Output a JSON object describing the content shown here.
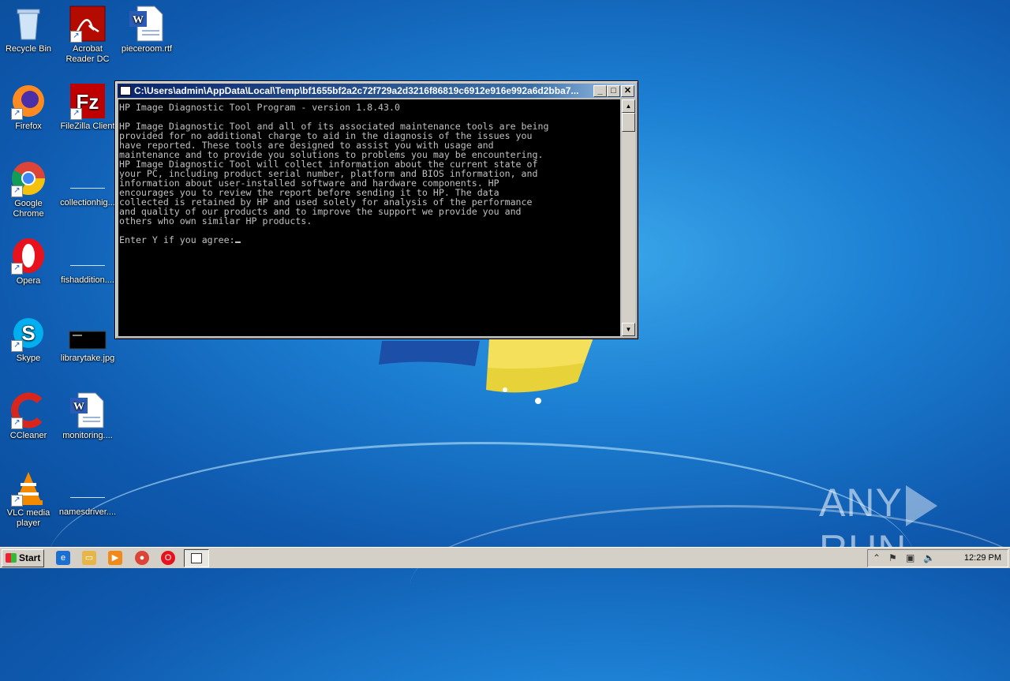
{
  "desktop": {
    "icons": [
      {
        "label": "Recycle Bin",
        "icon": "recycle-bin-icon"
      },
      {
        "label": "Acrobat\nReader DC",
        "icon": "acrobat-icon"
      },
      {
        "label": "pieceroom.rtf",
        "icon": "word-doc-icon"
      },
      {
        "label": "Firefox",
        "icon": "firefox-icon"
      },
      {
        "label": "FileZilla Client",
        "icon": "filezilla-icon"
      },
      {
        "label": "Google\nChrome",
        "icon": "chrome-icon"
      },
      {
        "label": "collectionhig...",
        "icon": "blank-file-icon"
      },
      {
        "label": "Opera",
        "icon": "opera-icon"
      },
      {
        "label": "fishaddition....",
        "icon": "blank-file-icon"
      },
      {
        "label": "Skype",
        "icon": "skype-icon"
      },
      {
        "label": "librarytake.jpg",
        "icon": "image-file-icon"
      },
      {
        "label": "CCleaner",
        "icon": "ccleaner-icon"
      },
      {
        "label": "monitoring....",
        "icon": "word-doc-icon"
      },
      {
        "label": "VLC media\nplayer",
        "icon": "vlc-icon"
      },
      {
        "label": "namesdriver....",
        "icon": "blank-file-icon"
      }
    ]
  },
  "window": {
    "title": "C:\\Users\\admin\\AppData\\Local\\Temp\\bf1655bf2a2c72f729a2d3216f86819c6912e916e992a6d2bba7...",
    "minimize": "_",
    "maximize": "□",
    "close": "✕"
  },
  "console": {
    "header": "HP Image Diagnostic Tool Program - version 1.8.43.0",
    "lines": [
      "HP Image Diagnostic Tool and all of its associated maintenance tools are being",
      "provided for no additional charge to aid in the diagnosis of the issues you",
      "have reported. These tools are designed to assist you with usage and",
      "maintenance and to provide you solutions to problems you may be encountering.",
      "HP Image Diagnostic Tool will collect information about the current state of",
      "your PC, including product serial number, platform and BIOS information, and",
      "information about user-installed software and hardware components. HP",
      "encourages you to review the report before sending it to HP. The data",
      "collected is retained by HP and used solely for analysis of the performance",
      "and quality of our products and to improve the support we provide you and",
      "others who own similar HP products."
    ],
    "prompt": "Enter Y if you agree:"
  },
  "watermark": {
    "left": "ANY",
    "right": "RUN"
  },
  "taskbar": {
    "start_label": "Start",
    "quick_launch": [
      "ie-icon",
      "explorer-icon",
      "media-player-icon",
      "chrome-icon",
      "opera-icon"
    ],
    "clock": "12:29 PM"
  },
  "colors": {
    "titlebar": "#0a246a",
    "console_bg": "#000000",
    "console_fg": "#c0c0c0",
    "taskbar": "#d4d0c8"
  }
}
